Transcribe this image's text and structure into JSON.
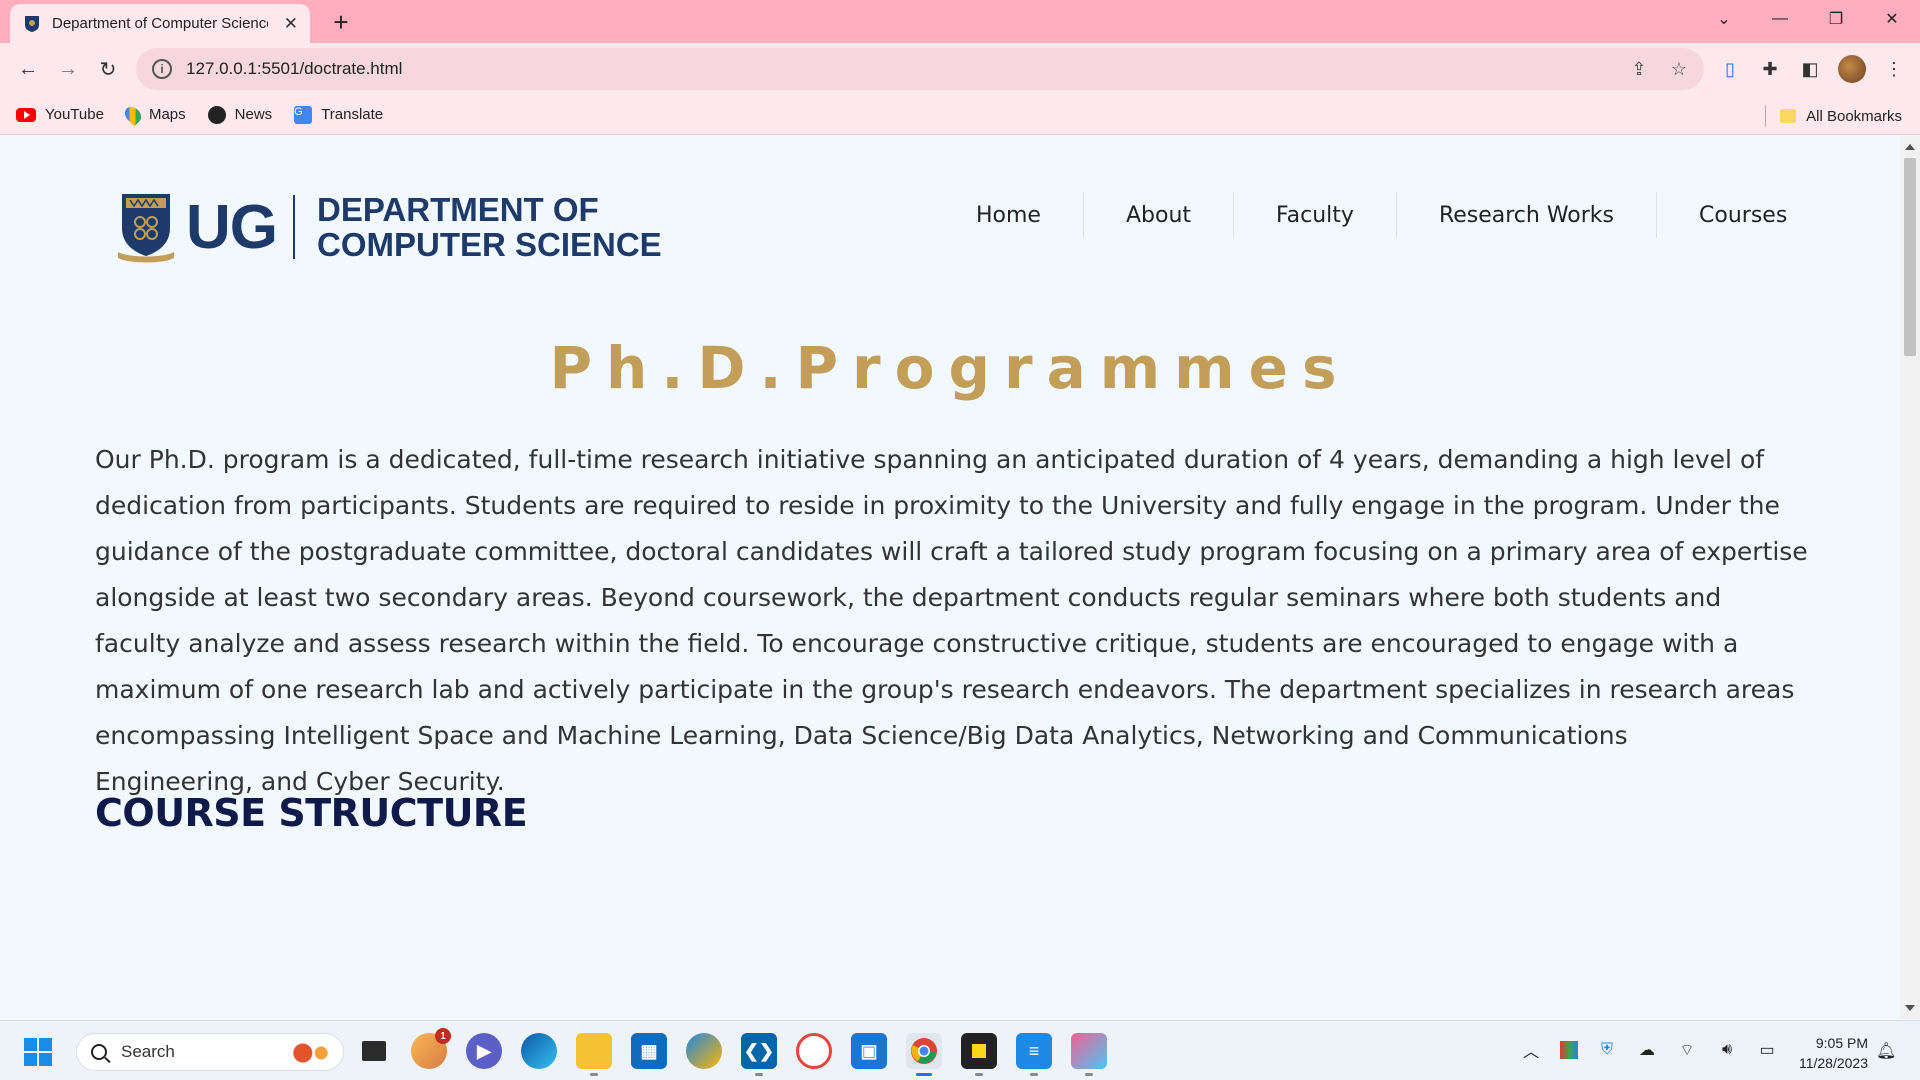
{
  "browser": {
    "tab_title": "Department of Computer Science",
    "url": "127.0.0.1:5501/doctrate.html",
    "bookmarks": [
      "YouTube",
      "Maps",
      "News",
      "Translate"
    ],
    "all_bookmarks": "All Bookmarks"
  },
  "site": {
    "logo_text": "UG",
    "dept_line1": "DEPARTMENT OF",
    "dept_line2": "COMPUTER SCIENCE",
    "nav": [
      "Home",
      "About",
      "Faculty",
      "Research Works",
      "Courses"
    ]
  },
  "main": {
    "heading": "Ph.D.Programmes",
    "paragraph": "Our Ph.D. program is a dedicated, full-time research initiative spanning an anticipated duration of 4 years, demanding a high level of dedication from participants. Students are required to reside in proximity to the University and fully engage in the program. Under the guidance of the postgraduate committee, doctoral candidates will craft a tailored study program focusing on a primary area of expertise alongside at least two secondary areas. Beyond coursework, the department conducts regular seminars where both students and faculty analyze and assess research within the field. To encourage constructive critique, students are encouraged to engage with a maximum of one research lab and actively participate in the group's research endeavors. The department specializes in research areas encompassing Intelligent Space and Machine Learning, Data Science/Big Data Analytics, Networking and Communications Engineering, and Cyber Security.",
    "paragraph_lines": [
      "Our Ph.D. program is a dedicated, full-time research initiative spanning an anticipated duration of 4 years, demanding a high level of",
      "dedication from participants. Students are required to reside in proximity to the University and fully engage in the program. Under the",
      "guidance of the postgraduate committee, doctoral candidates will craft a tailored study program focusing on a primary area of expertise",
      "alongside at least two secondary areas. Beyond coursework, the department conducts regular seminars where both students and",
      "faculty analyze and assess research within the field. To encourage constructive critique, students are encouraged to engage with a",
      "maximum of one research lab and actively participate in the group's research endeavors. The department specializes in research areas",
      "encompassing Intelligent Space and Machine Learning, Data Science/Big Data Analytics, Networking and Communications",
      "Engineering, and Cyber Security."
    ],
    "course_heading": "COURSE STRUCTURE"
  },
  "taskbar": {
    "search_placeholder": "Search",
    "time": "9:05 PM",
    "date": "11/28/2023",
    "badge_count": "1"
  },
  "colors": {
    "heading_gold": "#c29e59",
    "brand_navy": "#1e3a6a",
    "page_bg": "#f1f9ff",
    "tab_strip": "#fdadbe"
  }
}
